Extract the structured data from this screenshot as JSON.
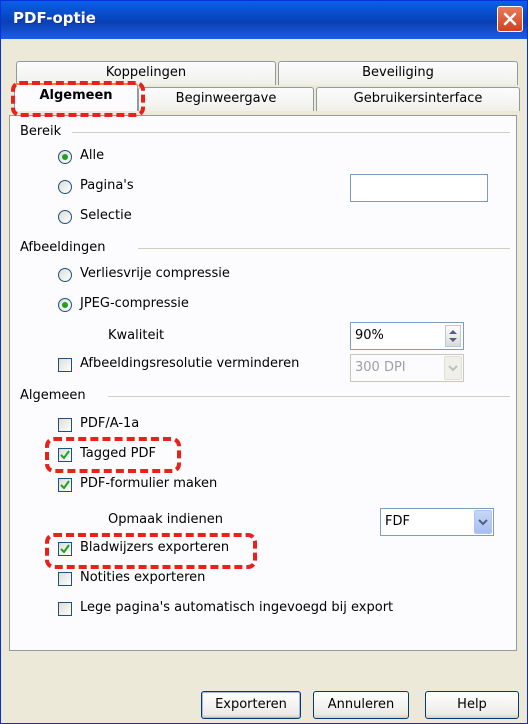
{
  "window": {
    "title": "PDF-optie"
  },
  "tabs": {
    "row1": [
      "Koppelingen",
      "Beveiliging"
    ],
    "row2": [
      "Algemeen",
      "Beginweergave",
      "Gebruikersinterface"
    ],
    "active": "Algemeen"
  },
  "bereik": {
    "heading": "Bereik",
    "options": [
      "Alle",
      "Pagina's",
      "Selectie"
    ],
    "selected": "Alle",
    "pages_value": ""
  },
  "afbeeldingen": {
    "heading": "Afbeeldingen",
    "options": [
      "Verliesvrije compressie",
      "JPEG-compressie"
    ],
    "selected": "JPEG-compressie",
    "quality_label": "Kwaliteit",
    "quality_value": "90%",
    "reduce_label": "Afbeeldingsresolutie verminderen",
    "reduce_checked": false,
    "resolution_value": "300 DPI"
  },
  "algemeen": {
    "heading": "Algemeen",
    "pdfa": {
      "label": "PDF/A-1a",
      "checked": false
    },
    "tagged": {
      "label": "Tagged PDF",
      "checked": true
    },
    "form": {
      "label": "PDF-formulier maken",
      "checked": true
    },
    "submit_label": "Opmaak indienen",
    "submit_value": "FDF",
    "bookmarks": {
      "label": "Bladwijzers exporteren",
      "checked": true
    },
    "notes": {
      "label": "Notities exporteren",
      "checked": false
    },
    "blank_pages": {
      "label": "Lege pagina's automatisch ingevoegd bij export",
      "checked": false
    }
  },
  "buttons": {
    "export": "Exporteren",
    "cancel": "Annuleren",
    "help": "Help"
  },
  "colors": {
    "title_bar": "#0a5fe8",
    "close_button": "#d4401c",
    "highlight": "#e8211c",
    "checkmark": "#21a121"
  }
}
